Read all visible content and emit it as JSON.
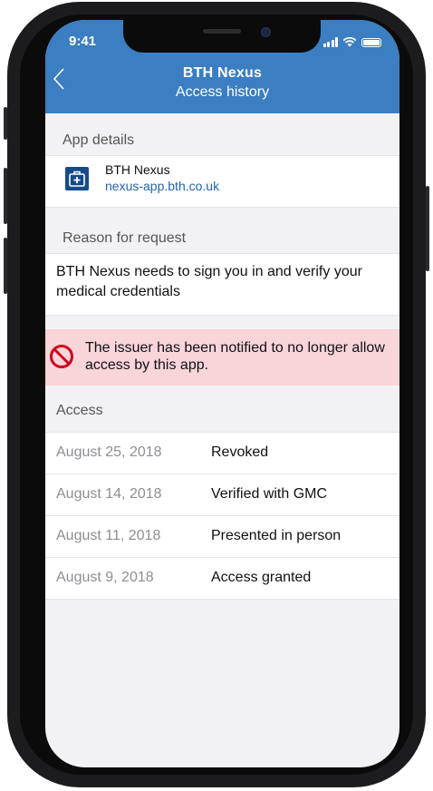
{
  "status_bar": {
    "time": "9:41"
  },
  "header": {
    "title": "BTH Nexus",
    "subtitle": "Access history"
  },
  "app_details": {
    "label": "App details",
    "app_name": "BTH Nexus",
    "app_url": "nexus-app.bth.co.uk",
    "icon": "medical-kit-icon"
  },
  "reason": {
    "label": "Reason for request",
    "text": "BTH Nexus needs to sign you in and verify your medical credentials"
  },
  "alert": {
    "icon": "no-entry-icon",
    "text": "The issuer has been notified to no longer allow access by this app.",
    "background": "#f8d5d9",
    "icon_color": "#d0021b"
  },
  "access": {
    "label": "Access",
    "rows": [
      {
        "date": "August 25, 2018",
        "status": "Revoked"
      },
      {
        "date": "August 14, 2018",
        "status": "Verified with GMC"
      },
      {
        "date": "August 11, 2018",
        "status": "Presented in person"
      },
      {
        "date": "August 9, 2018",
        "status": "Access granted"
      }
    ]
  },
  "colors": {
    "header": "#3b7ec1",
    "link": "#1f63b0",
    "app_icon": "#164a8d"
  }
}
